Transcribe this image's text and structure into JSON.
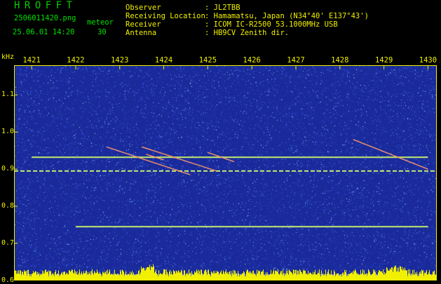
{
  "header": {
    "title": "HROFFT",
    "filename": "2506011420.png",
    "type_label": "meteor",
    "datetime": "25.06.01 14:20",
    "count": "30"
  },
  "station_info": [
    {
      "label": "Observer",
      "value": ": JL2TBB"
    },
    {
      "label": "Receiving Location",
      "value": ": Hamamatsu, Japan (N34°40' E137°43')"
    },
    {
      "label": "Receiver",
      "value": ": ICOM IC-R2500 53.1000MHz USB"
    },
    {
      "label": "Antenna",
      "value": ": HB9CV Zenith dir."
    }
  ],
  "chart_data": {
    "type": "spectrogram",
    "ylabel": "kHz",
    "x_ticks": [
      "1421",
      "1422",
      "1423",
      "1424",
      "1425",
      "1426",
      "1427",
      "1428",
      "1429",
      "1430"
    ],
    "y_ticks": [
      "1.1",
      "1.0",
      "0.9",
      "0.8",
      "0.7",
      "0.6"
    ],
    "xlim": [
      1420.6,
      1430.2
    ],
    "ylim": [
      0.6,
      1.18
    ],
    "horizontal_lines": [
      {
        "y": 0.932,
        "x_start": 1421.0,
        "x_end": 1430.0
      },
      {
        "y": 0.895,
        "x_start": 1420.6,
        "x_end": 1430.2
      },
      {
        "y": 0.745,
        "x_start": 1422.0,
        "x_end": 1430.0
      }
    ],
    "meteor_traces": [
      {
        "x": [
          1422.7,
          1424.6
        ],
        "y": [
          0.96,
          0.885
        ]
      },
      {
        "x": [
          1423.5,
          1425.2
        ],
        "y": [
          0.96,
          0.895
        ]
      },
      {
        "x": [
          1428.3,
          1430.0
        ],
        "y": [
          0.98,
          0.9
        ]
      },
      {
        "x": [
          1425.0,
          1425.6
        ],
        "y": [
          0.945,
          0.92
        ]
      },
      {
        "x": [
          1423.6,
          1424.0
        ],
        "y": [
          0.94,
          0.925
        ]
      }
    ],
    "colors": {
      "background": "#1a2a9a",
      "noise": "#4a78ff",
      "line": "#d6ff6a",
      "trace": "#ff9a66",
      "axis": "#f0f000",
      "bottom_bars": "#f0f000"
    }
  }
}
